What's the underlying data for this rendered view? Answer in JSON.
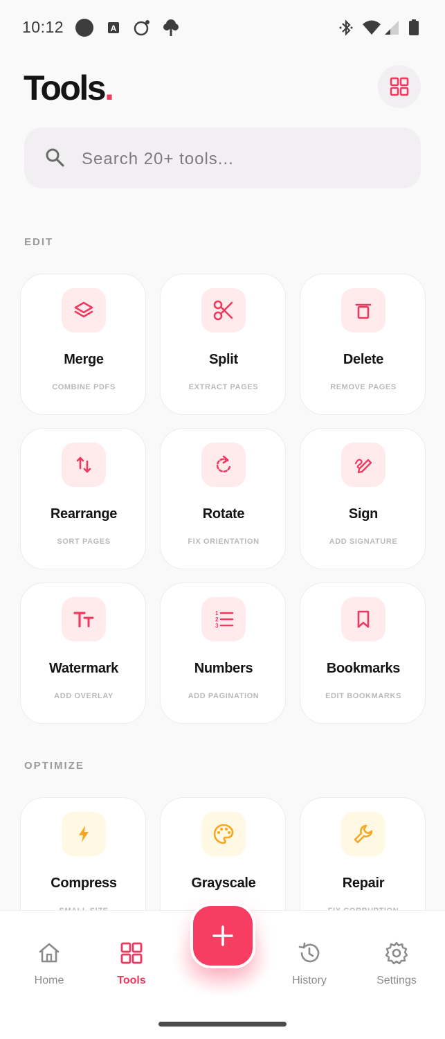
{
  "status_bar": {
    "time": "10:12",
    "icons": [
      "record-circle-icon",
      "keyboard-a-icon",
      "chat-bubble-icon",
      "tree-icon",
      "bluetooth-icon",
      "wifi-icon",
      "signal-icon",
      "battery-icon"
    ]
  },
  "header": {
    "title": "Tools",
    "title_dot": ".",
    "grid_icon": "grid-view-icon"
  },
  "search": {
    "placeholder": "Search 20+ tools...",
    "value": ""
  },
  "sections": {
    "edit": {
      "label": "EDIT",
      "tools": [
        {
          "title": "Merge",
          "subtitle": "COMBINE PDFS",
          "icon": "layers-icon"
        },
        {
          "title": "Split",
          "subtitle": "EXTRACT PAGES",
          "icon": "scissors-icon"
        },
        {
          "title": "Delete",
          "subtitle": "REMOVE PAGES",
          "icon": "trash-icon"
        },
        {
          "title": "Rearrange",
          "subtitle": "SORT PAGES",
          "icon": "swap-vertical-icon"
        },
        {
          "title": "Rotate",
          "subtitle": "FIX ORIENTATION",
          "icon": "rotate-icon"
        },
        {
          "title": "Sign",
          "subtitle": "ADD SIGNATURE",
          "icon": "signature-pen-icon"
        },
        {
          "title": "Watermark",
          "subtitle": "ADD OVERLAY",
          "icon": "text-size-icon"
        },
        {
          "title": "Numbers",
          "subtitle": "ADD PAGINATION",
          "icon": "numbered-list-icon"
        },
        {
          "title": "Bookmarks",
          "subtitle": "EDIT BOOKMARKS",
          "icon": "bookmark-icon"
        }
      ]
    },
    "optimize": {
      "label": "OPTIMIZE",
      "tools": [
        {
          "title": "Compress",
          "subtitle": "SMALL SIZE",
          "icon": "lightning-icon"
        },
        {
          "title": "Grayscale",
          "subtitle": "",
          "icon": "palette-icon"
        },
        {
          "title": "Repair",
          "subtitle": "FIX CORRUPTION",
          "icon": "wrench-icon"
        }
      ]
    }
  },
  "bottom_nav": {
    "items": [
      {
        "label": "Home",
        "icon": "home-icon"
      },
      {
        "label": "Tools",
        "icon": "grid-icon",
        "active": true
      },
      {
        "label": "History",
        "icon": "history-icon"
      },
      {
        "label": "Settings",
        "icon": "gear-icon"
      }
    ],
    "fab_icon": "plus-icon"
  },
  "colors": {
    "accent": "#f0395f",
    "accent_bg": "#ffeaec",
    "optimize_accent": "#f5a623",
    "optimize_bg": "#fff8e2"
  }
}
